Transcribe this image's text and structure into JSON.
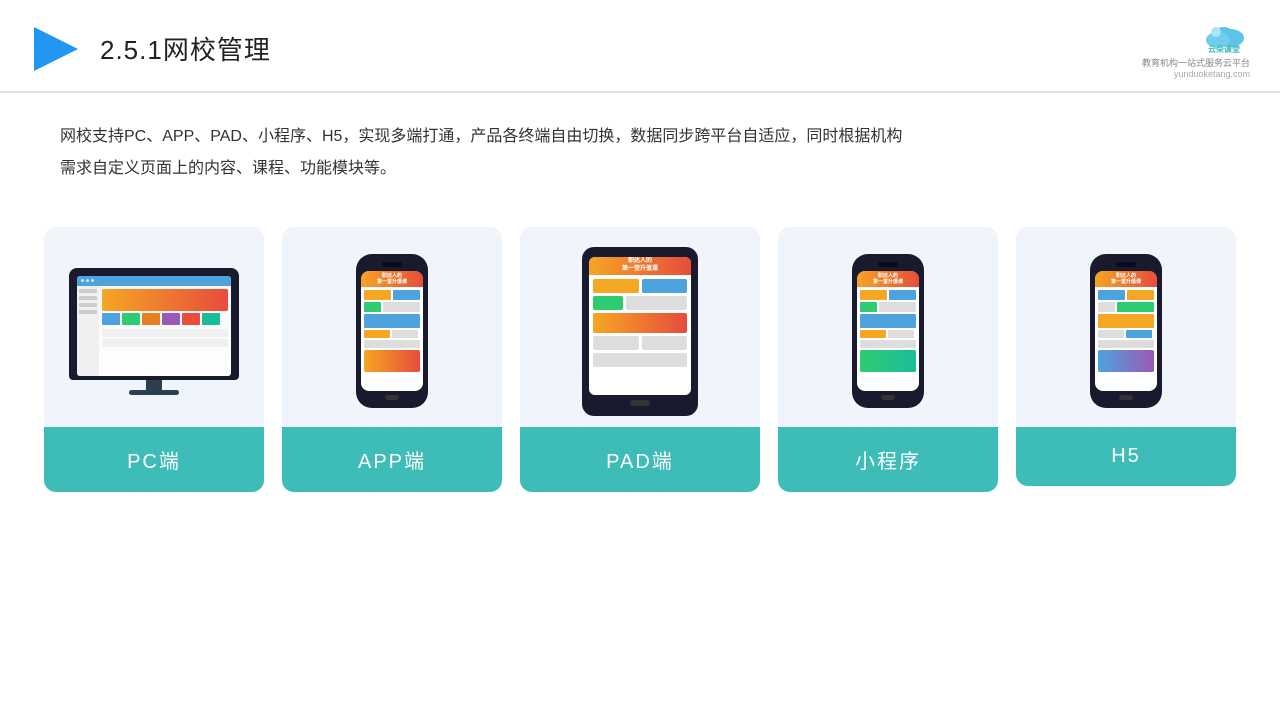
{
  "header": {
    "title": "2.5.1网校管理",
    "logo_name": "云朵课堂",
    "logo_url": "yunduoketang.com",
    "logo_tagline": "教育机构一站式服务云平台"
  },
  "description": {
    "text1": "网校支持PC、APP、PAD、小程序、H5，实现多端打通，产品各终端自由切换，数据同步跨平台自适应，同时根据机构",
    "text2": "需求自定义页面上的内容、课程、功能模块等。"
  },
  "devices": [
    {
      "id": "pc",
      "label": "PC端",
      "type": "pc"
    },
    {
      "id": "app",
      "label": "APP端",
      "type": "phone"
    },
    {
      "id": "pad",
      "label": "PAD端",
      "type": "tablet"
    },
    {
      "id": "mini",
      "label": "小程序",
      "type": "phone"
    },
    {
      "id": "h5",
      "label": "H5",
      "type": "phone"
    }
  ],
  "colors": {
    "accent": "#3dbcb8",
    "bg_card": "#f0f4fb",
    "header_line": "#e0e0e0"
  }
}
